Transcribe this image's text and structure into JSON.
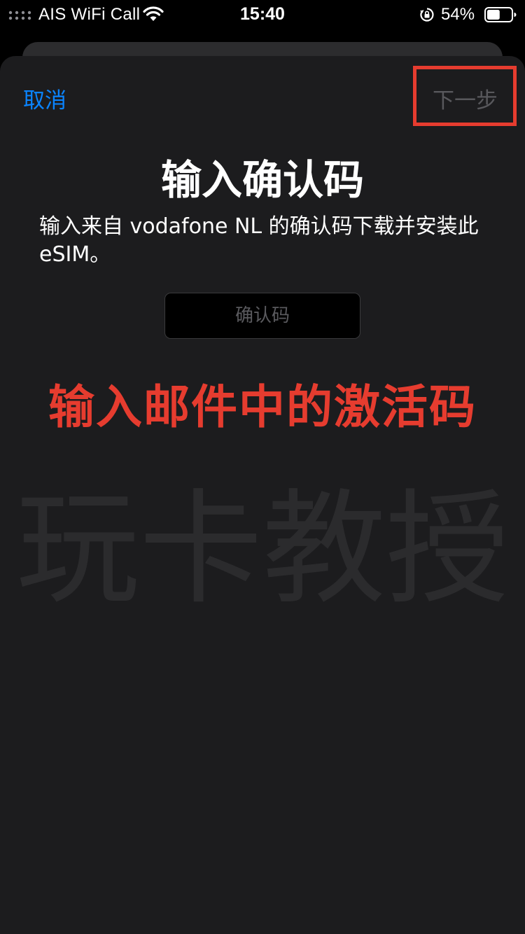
{
  "status_bar": {
    "carrier": "AIS WiFi Call",
    "time": "15:40",
    "battery_percent": "54%",
    "battery_level": 0.54,
    "icons": [
      "signal-dots-icon",
      "wifi-icon",
      "rotation-lock-icon",
      "battery-icon"
    ]
  },
  "nav": {
    "cancel_label": "取消",
    "next_label": "下一步"
  },
  "main": {
    "title": "输入确认码",
    "description": "输入来自 vodafone NL 的确认码下载并安装此eSIM。",
    "code_input": {
      "placeholder": "确认码",
      "value": ""
    }
  },
  "annotation": {
    "text": "输入邮件中的激活码",
    "color": "#e63c2f"
  },
  "watermark": {
    "text": "玩卡教授"
  },
  "colors": {
    "accent": "#0a84ff",
    "disabled": "#58585c",
    "highlight": "#e63c2f",
    "sheet_background": "#1c1c1e"
  }
}
